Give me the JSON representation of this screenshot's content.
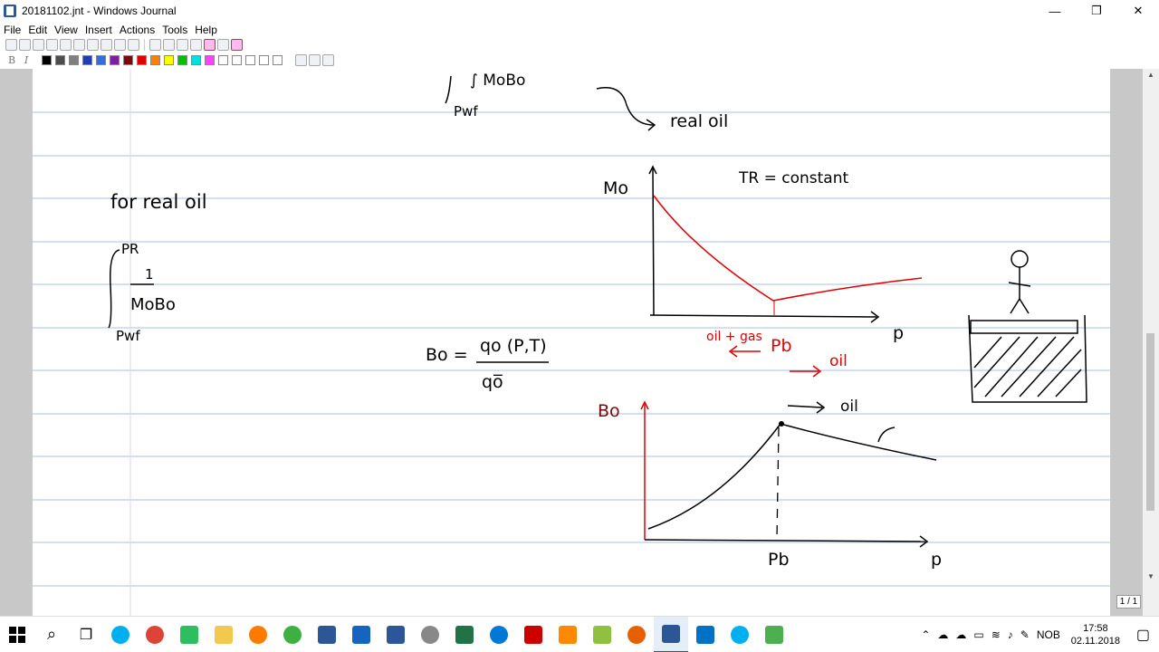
{
  "window": {
    "title": "20181102.jnt - Windows Journal",
    "minimize": "—",
    "maximize": "❐",
    "close": "✕"
  },
  "menu": [
    "File",
    "Edit",
    "View",
    "Insert",
    "Actions",
    "Tools",
    "Help"
  ],
  "format": {
    "bold": "B",
    "italic": "I"
  },
  "pen_colors": [
    "#000000",
    "#4d4d4d",
    "#808080",
    "#1f3fb0",
    "#2f6fe0",
    "#7f1fa0",
    "#7a0a0a",
    "#e00000",
    "#ff8000",
    "#ffff00",
    "#00c000",
    "#00e0e0",
    "#ff40ff",
    "#ffffff",
    "#ffffff",
    "#ffffff",
    "#ffffff",
    "#ffffff"
  ],
  "scroll": {
    "up": "▲",
    "down": "▼"
  },
  "notes": {
    "top_integral": "∫ MoBo",
    "top_lower_limit": "Pwf",
    "top_arrow_label": "real oil",
    "for_real_oil": "for real oil",
    "integral_upper": "PR",
    "integral_numerator": "1",
    "integral_denominator": "MoBo",
    "integral_lower": "Pwf",
    "bo_lhs": "Bo =",
    "bo_numerator": "qo (P,T)",
    "bo_denominator": "qo̅",
    "mu_axis_label": "Mo",
    "tr_constant": "TR = constant",
    "p_axis_label": "p",
    "oil_gas": "oil + gas",
    "pb_label": "Pb",
    "oil_label": "oil",
    "bo_axis_label": "Bo",
    "oil_label_2": "oil",
    "pb_bottom": "Pb",
    "p_axis_label_2": "p"
  },
  "page_indicator": "1 / 1",
  "taskbar": {
    "apps": [
      "windows-start",
      "search",
      "task-view",
      "skype",
      "chrome",
      "evernote",
      "file-explorer",
      "search-app",
      "sync-app",
      "floppy-app",
      "tasks-app",
      "word",
      "app-13",
      "excel",
      "edge",
      "acrobat",
      "vlc",
      "notepadpp",
      "firefox",
      "journal",
      "outlook",
      "skype-business",
      "camtasia"
    ],
    "language": "NOB",
    "time": "17:58",
    "date": "02.11.2018"
  }
}
